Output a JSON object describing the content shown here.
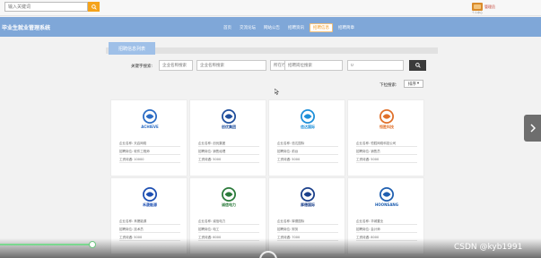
{
  "search": {
    "placeholder": "输入关键词"
  },
  "user": {
    "name": "管理员",
    "sub": "个人中心"
  },
  "header": {
    "title": "毕业生就业管理系统",
    "nav": [
      "首页",
      "交流论坛",
      "网站公告",
      "招聘资讯",
      "招聘信息",
      "招聘简章"
    ],
    "active_index": 4
  },
  "section": {
    "tab_label": "招聘信息列表"
  },
  "filters": {
    "label": "关键字搜索:",
    "company_placeholder": "企业名称搜索",
    "industry_placeholder": "所在行业搜索",
    "position_placeholder": "招聘岗位搜索",
    "last_value": "0"
  },
  "sort": {
    "label": "下拉搜索:",
    "value": "排序"
  },
  "cards": [
    {
      "logo_text": "ACHIEVE",
      "logo_color": "#2b6cc4",
      "company": "企业名称: 天启网络",
      "position": "招聘岗位: 软件工程师",
      "salary": "工资待遇: 10000"
    },
    {
      "logo_text": "创优集团",
      "logo_color": "#1f4e9c",
      "company": "企业名称: 创优集团",
      "position": "招聘岗位: 销售经理",
      "salary": "工资待遇: 5000"
    },
    {
      "logo_text": "信达国际",
      "logo_color": "#1d8fd9",
      "company": "企业名称: 信达国际",
      "position": "招聘岗位: 前台",
      "salary": "工资待遇: 5000"
    },
    {
      "logo_text": "恒胜科技",
      "logo_color": "#e0702a",
      "company": "企业名称: 恒胜网络科技公司",
      "position": "招聘岗位: 销售员",
      "salary": "工资待遇: 5000"
    },
    {
      "logo_text": "禾晟能源",
      "logo_color": "#1d4fb2",
      "company": "企业名称: 禾晟能源",
      "position": "招聘岗位: 技术员",
      "salary": "工资待遇: 5000"
    },
    {
      "logo_text": "诚信电力",
      "logo_color": "#2a7a3a",
      "company": "企业名称: 诚信电力",
      "position": "招聘岗位: 电工",
      "salary": "工资待遇: 6000"
    },
    {
      "logo_text": "厚德国际",
      "logo_color": "#1a3f8a",
      "company": "企业名称: 厚德国际",
      "position": "招聘岗位: 财务",
      "salary": "工资待遇: 7000"
    },
    {
      "logo_text": "HOONSANG",
      "logo_color": "#1f5fb0",
      "company": "企业名称: 华城置业",
      "position": "招聘岗位: 会计师",
      "salary": "工资待遇: 8000"
    }
  ],
  "video": {
    "progress": 0.17
  },
  "watermark": "CSDN @kyb1991"
}
